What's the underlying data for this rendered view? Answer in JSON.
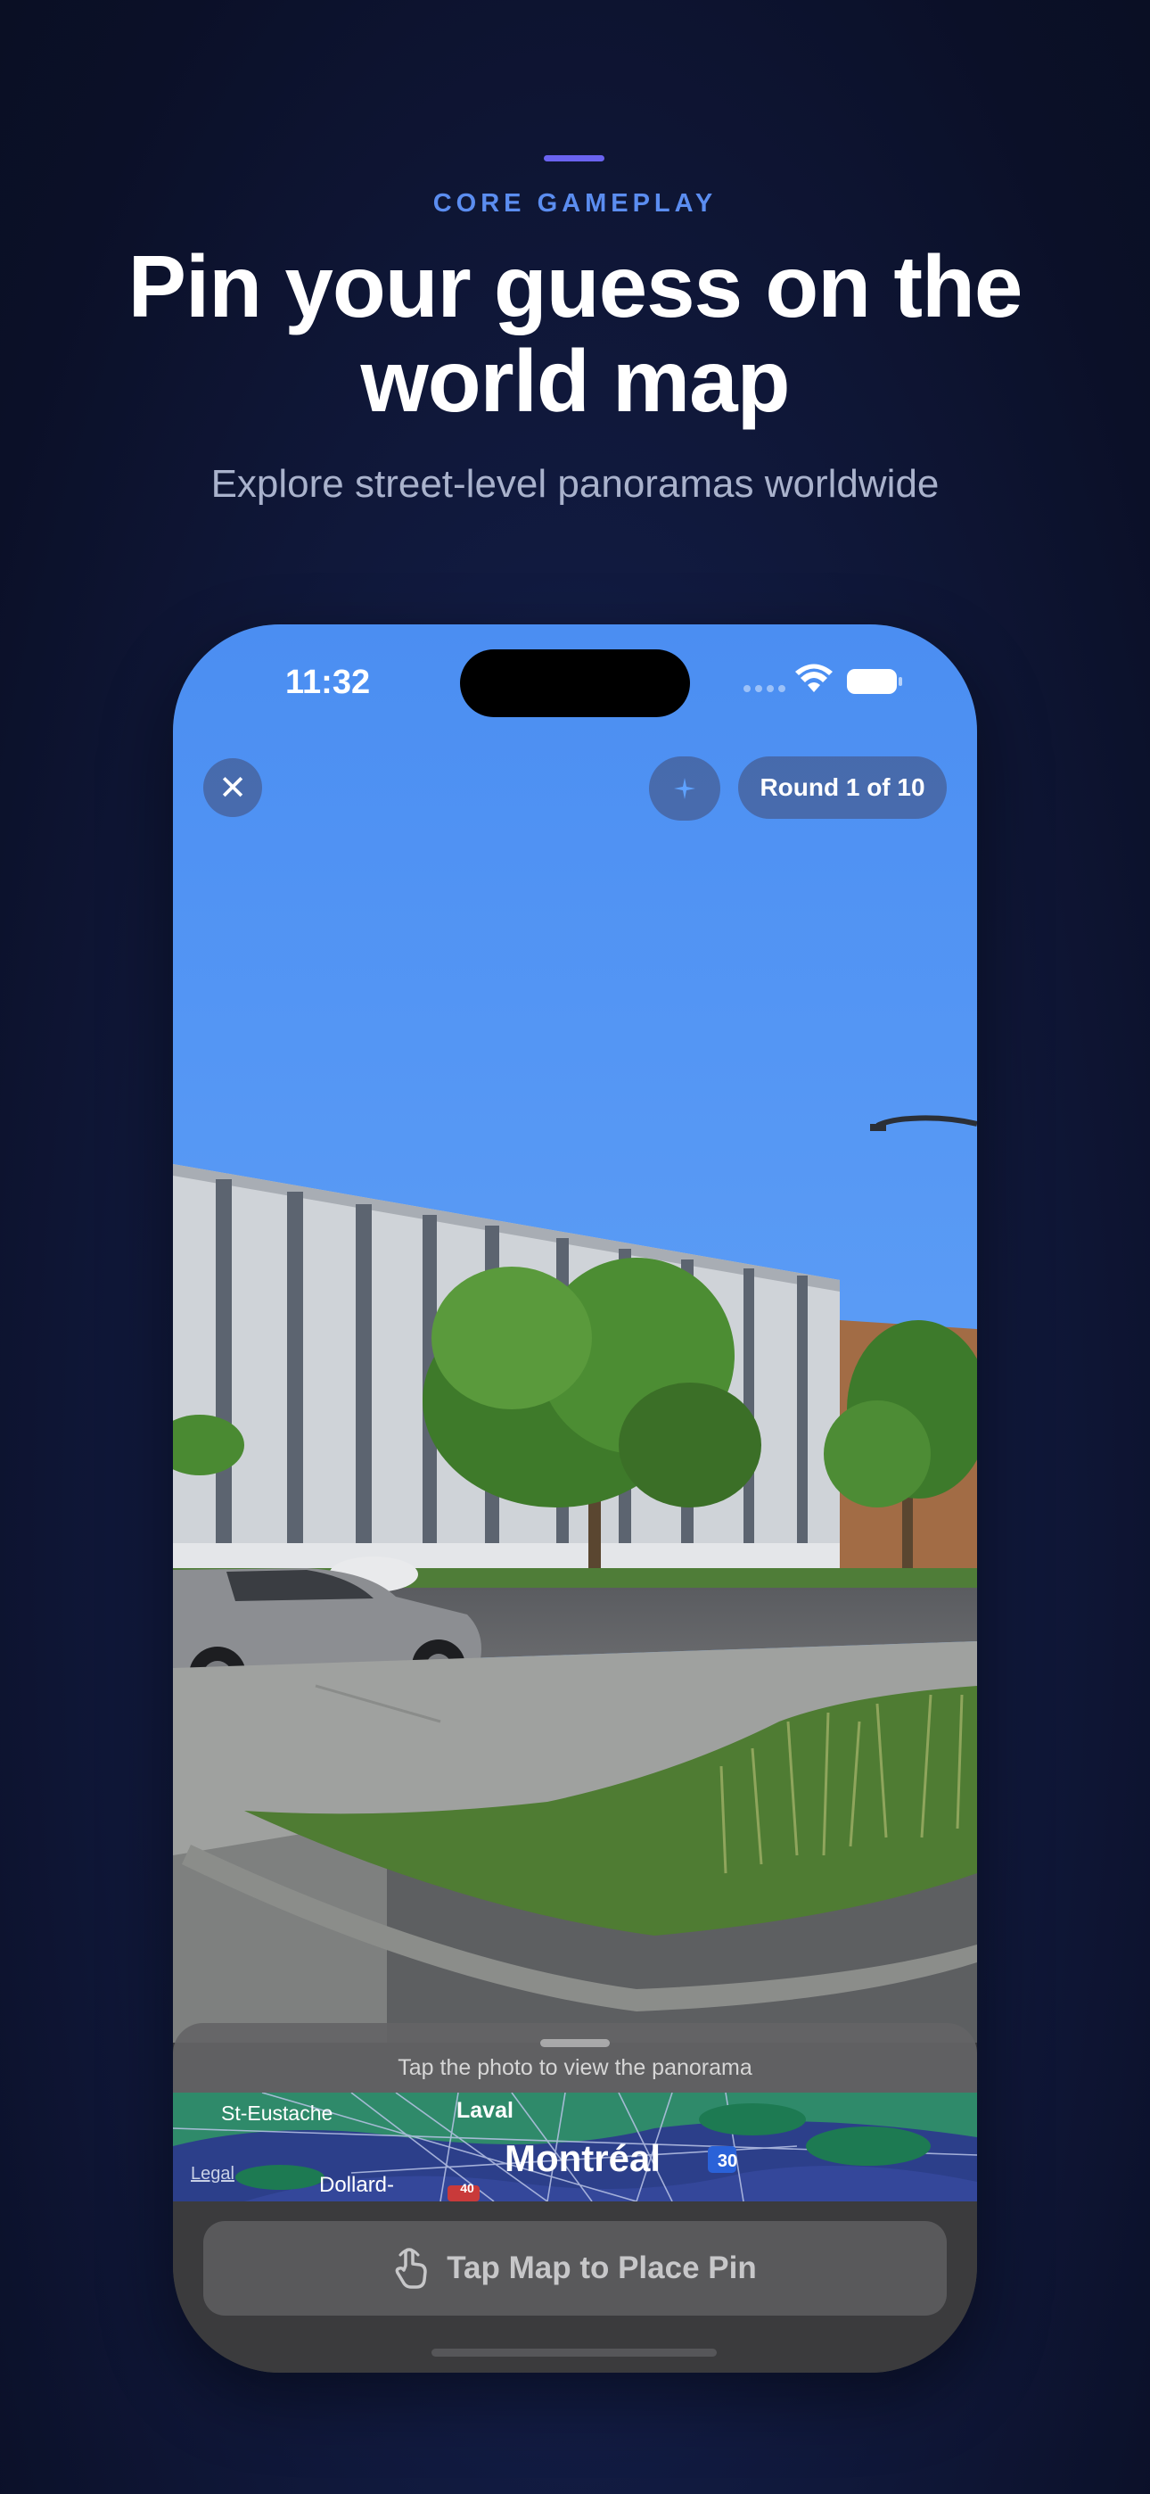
{
  "header": {
    "eyebrow": "CORE GAMEPLAY",
    "headline_line1": "Pin your guess on the",
    "headline_line2": "world map",
    "subhead": "Explore street-level panoramas worldwide"
  },
  "status_bar": {
    "time": "11:32"
  },
  "game": {
    "close_icon": "close-icon",
    "hint_icon": "sparkle-icon",
    "round_label": "Round 1 of 10"
  },
  "sheet": {
    "hint": "Tap the photo to view the panorama",
    "map_labels": {
      "st_eustache": "St-Eustache",
      "laval": "Laval",
      "montreal": "Montréal",
      "dollard": "Dollard-",
      "legal": "Legal",
      "hwy_30": "30",
      "hwy_40": "40"
    },
    "place_pin_label": "Tap Map to Place Pin",
    "place_pin_icon": "hand-tap-icon"
  },
  "colors": {
    "background": "#111a3f",
    "accent": "#6a63f0",
    "eyebrow": "#5b8df0",
    "sky": "#4f93f4"
  }
}
